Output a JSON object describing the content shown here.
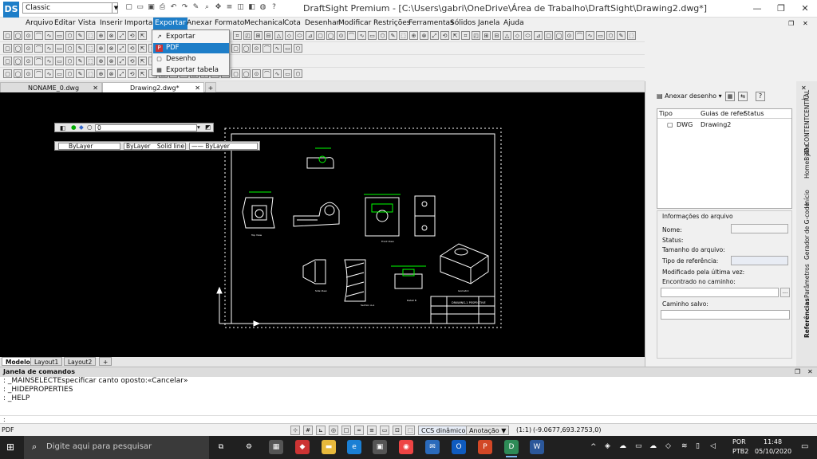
{
  "titlebar": {
    "logo": "DS",
    "workspace": "Classic",
    "title": "DraftSight Premium - [C:\\Users\\gabri\\OneDrive\\Área de Trabalho\\DraftSight\\Drawing2.dwg*]",
    "minimize": "—",
    "maximize": "❐",
    "close": "✕"
  },
  "menubar": [
    "Arquivo",
    "Editar",
    "Vista",
    "Inserir",
    "Importar",
    "Exportar",
    "Anexar",
    "Formato",
    "Mechanical",
    "Cota",
    "Desenhar",
    "Modificar",
    "Restrições",
    "Ferramentas",
    "Sólidos",
    "Janela",
    "Ajuda"
  ],
  "export_menu": [
    "Exportar",
    "PDF",
    "Desenho",
    "Exportar tabela"
  ],
  "doc_tabs": [
    {
      "label": "NONAME_0.dwg"
    },
    {
      "label": "Drawing2.dwg*"
    }
  ],
  "add_tab": "+",
  "layout_tabs": [
    "Modelo",
    "Layout1",
    "Layout2"
  ],
  "canvas_toolbar": {
    "layer": "0",
    "color": "ByLayer",
    "linestyle": "ByLayer",
    "linetype": "Solid line",
    "lineweight": "—— ByLayer"
  },
  "drawing": {
    "title_block": "DRAWING-1 PESPECTIVE",
    "view_labels": [
      "Top View",
      "Front View",
      "Side View",
      "Section A-A",
      "Detail B",
      "Isometric"
    ]
  },
  "right_panel": {
    "attach_button": "Anexar desenho",
    "columns": [
      "Tipo",
      "Guias de refer",
      "Status"
    ],
    "rows": [
      {
        "type": "DWG",
        "name": "Drawing2"
      }
    ],
    "info_title": "Informações do arquivo",
    "fields": [
      "Nome:",
      "Status:",
      "Tamanho do arquivo:",
      "Tipo de referência:",
      "Modificado pela última vez:",
      "Encontrado no caminho:",
      "Caminho salvo:"
    ],
    "more_button": "...",
    "help_button": "?",
    "title": "Referências"
  },
  "side_tabs": [
    "3D CONTENTCENTRAL",
    "HomeByMe",
    "Início",
    "Gerador de G-code",
    "Parâmetros",
    "Referências"
  ],
  "command_window": {
    "title": "Janela de comandos",
    "lines": [
      ": _MAINSELECTEspecificar canto oposto:«Cancelar»",
      ": _HIDEPROPERTIES",
      ": _HELP"
    ],
    "prompt": ":"
  },
  "statusbar": {
    "left": "PDF",
    "ccs": "CCS dinâmico",
    "annotation": "Anotação",
    "scale": "(1:1)",
    "coords": "(-9.0677,693.2753,0)"
  },
  "taskbar": {
    "search_placeholder": "Digite aqui para pesquisar",
    "lang": "POR",
    "layout": "PTB2",
    "time": "11:48",
    "date": "05/10/2020"
  },
  "colors": {
    "accent": "#1e7ec8",
    "drawing_line": "#ffffff",
    "dimension": "#00ff00",
    "canvas": "#000000"
  }
}
